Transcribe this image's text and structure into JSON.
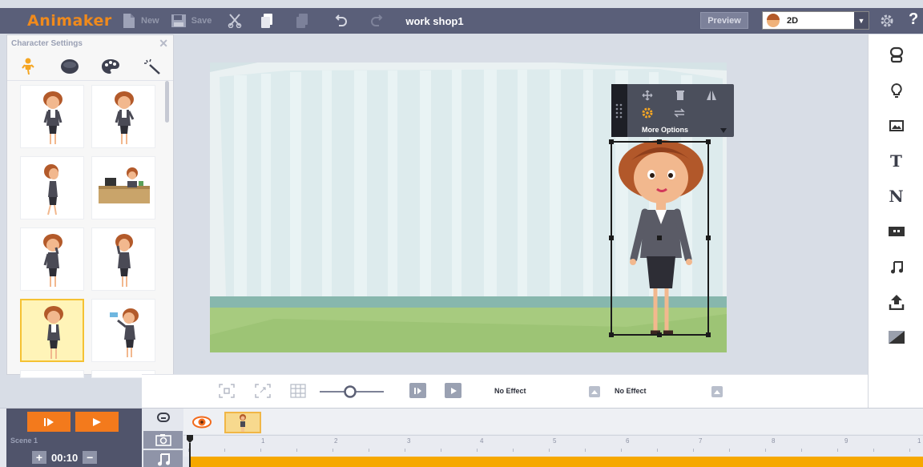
{
  "app": {
    "logo": "Animaker",
    "project_title": "work shop1"
  },
  "toolbar": {
    "new_label": "New",
    "save_label": "Save",
    "preview_label": "Preview",
    "mode_value": "2D"
  },
  "character_panel": {
    "title": "Character Settings",
    "tabs": [
      "character-pose-tab",
      "expression-tab",
      "color-palette-tab",
      "effects-tab"
    ]
  },
  "floating_toolbar": {
    "more_options_label": "More Options"
  },
  "controls": {
    "effect_in_label": "No Effect",
    "effect_out_label": "No Effect"
  },
  "timeline": {
    "scene_label": "Scene 1",
    "duration": "00:10",
    "ruler_marks": [
      "1",
      "2",
      "3",
      "4",
      "5",
      "6",
      "7",
      "8",
      "9",
      "1"
    ]
  },
  "colors": {
    "toolbar_bg": "#5a5f79",
    "accent_orange": "#f37a1c",
    "timeline_track": "#f6a800",
    "stage_floor": "#9dc475"
  }
}
